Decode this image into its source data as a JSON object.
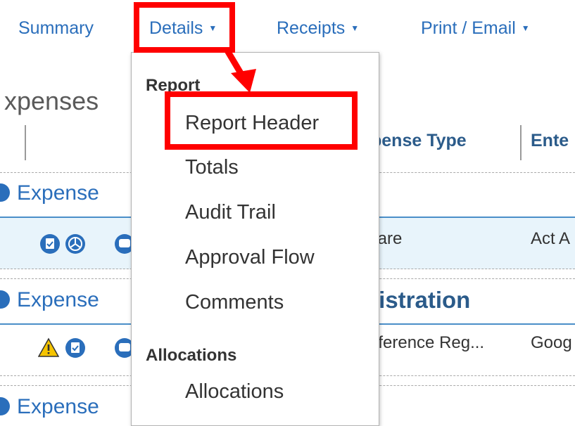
{
  "nav": {
    "summary": "Summary",
    "details": "Details",
    "receipts": "Receipts",
    "print_email": "Print / Email",
    "caret": "▼"
  },
  "page": {
    "title": "xpenses",
    "columns": {
      "expense_type": "pense Type",
      "entered": "Ente"
    },
    "groups": [
      {
        "label": "Expense"
      },
      {
        "label": "Expense",
        "bold_label": "gistration"
      },
      {
        "label": "Expense"
      }
    ],
    "rows": [
      {
        "expense_type": "fare",
        "entered": "Act A",
        "icons": [
          "receipt-icon",
          "itemized-icon",
          "comment-icon"
        ]
      },
      {
        "expense_type": "nference Reg...",
        "entered": "Goog",
        "icons": [
          "warning-icon",
          "receipt-icon",
          "comment-icon"
        ]
      }
    ]
  },
  "dropdown": {
    "section_report": "Report",
    "items": [
      "Report Header",
      "Totals",
      "Audit Trail",
      "Approval Flow",
      "Comments"
    ],
    "section_allocations": "Allocations",
    "allocation_items": [
      "Allocations"
    ]
  },
  "colors": {
    "link_blue": "#2a6ebb",
    "highlight_red": "#ff0000",
    "row_selected": "#e8f4fb",
    "warning_yellow": "#f5c400"
  }
}
